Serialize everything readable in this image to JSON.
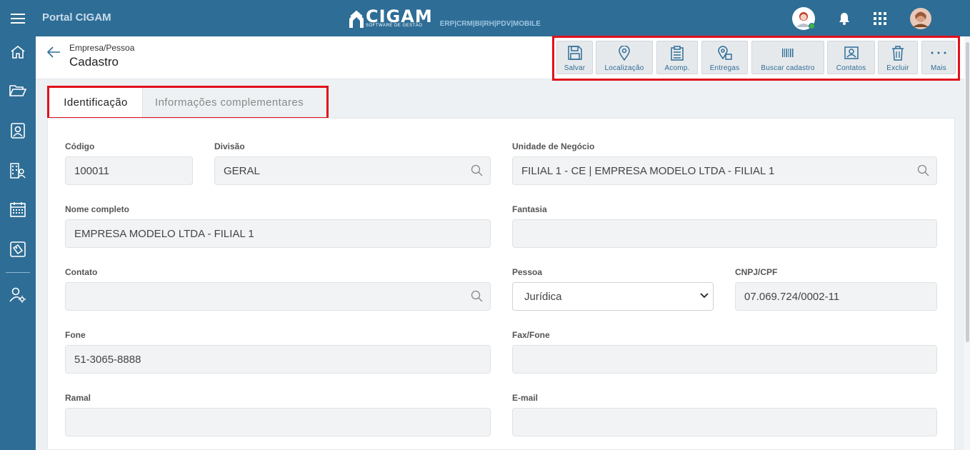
{
  "topbar": {
    "portal_title": "Portal CIGAM",
    "logo_word": "CIGAM",
    "logo_sub": "SOFTWARE DE GESTÃO",
    "modules": "ERP|CRM|BI|RH|PDV|MOBILE"
  },
  "sidebar": {
    "items": [
      "home-icon",
      "folder-icon",
      "contacts-icon",
      "building-icon",
      "calendar-icon",
      "tag-icon",
      "user-settings-icon"
    ]
  },
  "header": {
    "breadcrumb": "Empresa/Pessoa",
    "title": "Cadastro"
  },
  "toolbar": {
    "buttons": [
      {
        "label": "Salvar",
        "icon": "save-icon"
      },
      {
        "label": "Localização",
        "icon": "location-icon"
      },
      {
        "label": "Acomp.",
        "icon": "clipboard-icon"
      },
      {
        "label": "Entregas",
        "icon": "delivery-icon"
      },
      {
        "label": "Buscar cadastro",
        "icon": "barcode-icon"
      },
      {
        "label": "Contatos",
        "icon": "contact-card-icon"
      },
      {
        "label": "Excluir",
        "icon": "trash-icon"
      },
      {
        "label": "Mais",
        "icon": "more-icon"
      }
    ]
  },
  "tabs": [
    {
      "label": "Identificação",
      "active": true
    },
    {
      "label": "Informações complementares",
      "active": false
    }
  ],
  "form": {
    "codigo": {
      "label": "Código",
      "value": "100011"
    },
    "divisao": {
      "label": "Divisão",
      "value": "GERAL"
    },
    "unidade": {
      "label": "Unidade de Negócio",
      "value": "FILIAL 1 - CE | EMPRESA MODELO LTDA - FILIAL 1"
    },
    "nome": {
      "label": "Nome completo",
      "value": "EMPRESA MODELO LTDA - FILIAL 1"
    },
    "fantasia": {
      "label": "Fantasia",
      "value": ""
    },
    "contato": {
      "label": "Contato",
      "value": ""
    },
    "pessoa": {
      "label": "Pessoa",
      "value": "Jurídica"
    },
    "cnpj": {
      "label": "CNPJ/CPF",
      "value": "07.069.724/0002-11"
    },
    "fone": {
      "label": "Fone",
      "value": "51-3065-8888"
    },
    "fax": {
      "label": "Fax/Fone",
      "value": ""
    },
    "ramal": {
      "label": "Ramal",
      "value": ""
    },
    "email": {
      "label": "E-mail",
      "value": ""
    }
  },
  "colors": {
    "brand": "#2e6d96",
    "highlight": "#e0111d"
  }
}
